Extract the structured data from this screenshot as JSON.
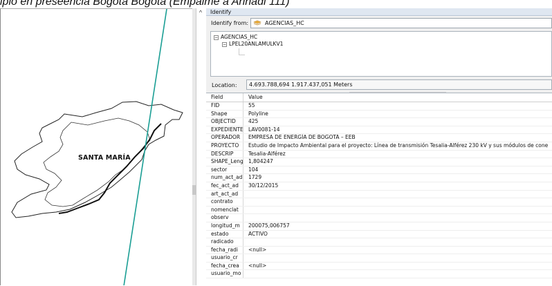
{
  "caption": "ipio en preseencia Bogotá Bogotá (Empalme a Ariñadi 111)",
  "map": {
    "label": "SANTA MARÍA"
  },
  "identify": {
    "title": "Identify",
    "from_label": "Identify from:",
    "from_value": "AGENCIAS_HC",
    "tree": {
      "root": "AGENCIAS_HC",
      "child": "LPEL20ANLAMULKV1"
    },
    "location_label": "Location:",
    "location_value": "4.693.788,694  1.917.437,051 Meters",
    "columns": [
      "Field",
      "Value"
    ],
    "rows": [
      {
        "field": "FID",
        "value": "55"
      },
      {
        "field": "Shape",
        "value": "Polyline"
      },
      {
        "field": "OBJECTID",
        "value": "425"
      },
      {
        "field": "EXPEDIENTE",
        "value": "LAV0081-14"
      },
      {
        "field": "OPERADOR",
        "value": "EMPRESA DE ENERGÍA DE BOGOTÁ – EEB"
      },
      {
        "field": "PROYECTO",
        "value": "Estudio de Impacto Ambiental para el proyecto: Línea de transmisión Tesalia-Alférez 230 kV y sus módulos de cone"
      },
      {
        "field": "DESCRIP",
        "value": "Tesalia-Alférez"
      },
      {
        "field": "SHAPE_Leng",
        "value": "1,804247"
      },
      {
        "field": "sector",
        "value": "104"
      },
      {
        "field": "num_act_ad",
        "value": "1729"
      },
      {
        "field": "fec_act_ad",
        "value": "30/12/2015"
      },
      {
        "field": "art_act_ad",
        "value": ""
      },
      {
        "field": "contrato",
        "value": ""
      },
      {
        "field": "nomenclat",
        "value": ""
      },
      {
        "field": "observ",
        "value": ""
      },
      {
        "field": "longitud_m",
        "value": "200075,006757"
      },
      {
        "field": "estado",
        "value": "ACTIVO"
      },
      {
        "field": "radicado",
        "value": ""
      },
      {
        "field": "fecha_radi",
        "value": "<null>"
      },
      {
        "field": "usuario_cr",
        "value": ""
      },
      {
        "field": "fecha_crea",
        "value": "<null>"
      },
      {
        "field": "usuario_mo",
        "value": ""
      }
    ]
  },
  "colors": {
    "transmission_line": "#1a9e94",
    "boundary": "#222222"
  }
}
